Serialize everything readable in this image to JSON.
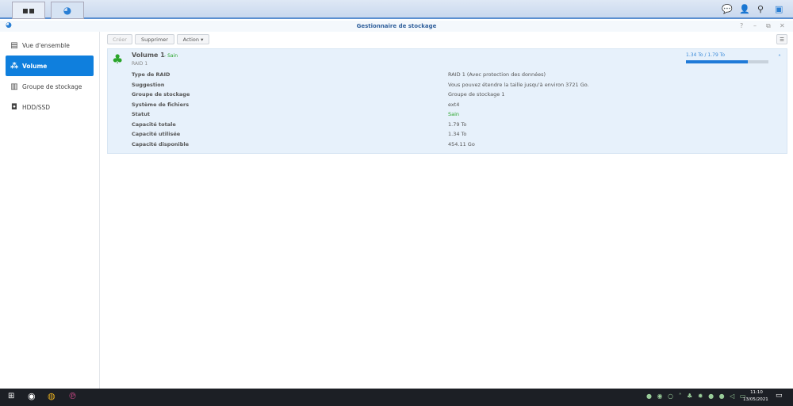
{
  "window": {
    "title": "Gestionnaire de stockage"
  },
  "toolbar": {
    "create": "Créer",
    "delete": "Supprimer",
    "action": "Action ▾"
  },
  "sidebar": {
    "items": [
      {
        "label": "Vue d'ensemble"
      },
      {
        "label": "Volume"
      },
      {
        "label": "Groupe de stockage"
      },
      {
        "label": "HDD/SSD"
      }
    ]
  },
  "volume": {
    "name": "Volume 1",
    "status_short": "- Sain",
    "subtitle": "RAID 1",
    "usage_text": "1.34 To / 1.79 To",
    "usage_fraction": 0.75,
    "rows": [
      {
        "label": "Type de RAID",
        "value": "RAID 1 (Avec protection des données)"
      },
      {
        "label": "Suggestion",
        "value": "Vous pouvez étendre la taille jusqu'à environ 3721 Go."
      },
      {
        "label": "Groupe de stockage",
        "value": "Groupe de stockage 1"
      },
      {
        "label": "Système de fichiers",
        "value": "ext4"
      },
      {
        "label": "Statut",
        "value": "Sain"
      },
      {
        "label": "Capacité totale",
        "value": "1.79 To"
      },
      {
        "label": "Capacité utilisée",
        "value": "1.34 To"
      },
      {
        "label": "Capacité disponible",
        "value": "454.11 Go"
      }
    ]
  },
  "taskbar": {
    "time": "11:10",
    "date": "13/05/2021"
  },
  "colors": {
    "accent": "#0f7fdd",
    "healthy": "#2aa52a"
  }
}
